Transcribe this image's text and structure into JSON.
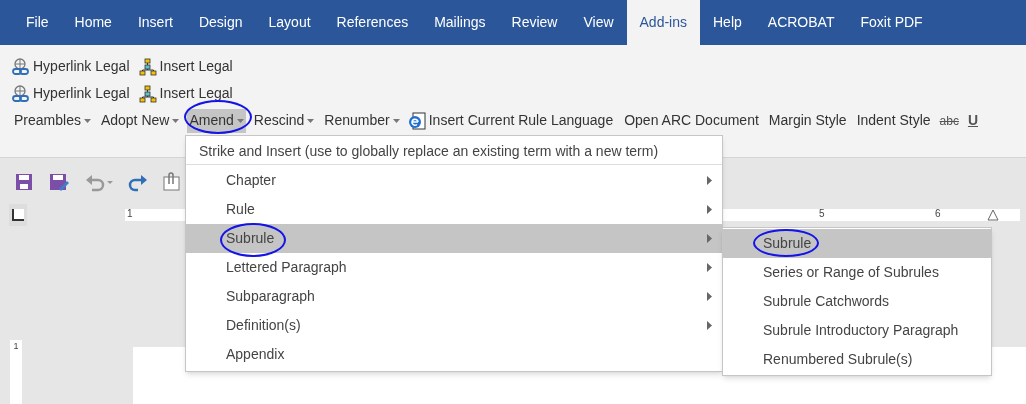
{
  "tabs": [
    {
      "label": "File",
      "selected": false
    },
    {
      "label": "Home",
      "selected": false
    },
    {
      "label": "Insert",
      "selected": false
    },
    {
      "label": "Design",
      "selected": false
    },
    {
      "label": "Layout",
      "selected": false
    },
    {
      "label": "References",
      "selected": false
    },
    {
      "label": "Mailings",
      "selected": false
    },
    {
      "label": "Review",
      "selected": false
    },
    {
      "label": "View",
      "selected": false
    },
    {
      "label": "Add-ins",
      "selected": true
    },
    {
      "label": "Help",
      "selected": false
    },
    {
      "label": "ACROBAT",
      "selected": false
    },
    {
      "label": "Foxit PDF",
      "selected": false
    }
  ],
  "ribbon": {
    "rows": [
      [
        {
          "kind": "hyperlink",
          "label": "Hyperlink Legal"
        },
        {
          "kind": "tree",
          "label": "Insert Legal"
        }
      ],
      [
        {
          "kind": "hyperlink",
          "label": "Hyperlink Legal"
        },
        {
          "kind": "tree",
          "label": "Insert Legal"
        }
      ],
      [
        {
          "kind": "dropdown",
          "label": "Preambles",
          "selected": false
        },
        {
          "kind": "dropdown",
          "label": "Adopt New",
          "selected": false
        },
        {
          "kind": "dropdown",
          "label": "Amend",
          "selected": true
        },
        {
          "kind": "dropdown",
          "label": "Rescind",
          "selected": false
        },
        {
          "kind": "dropdown",
          "label": "Renumber",
          "selected": false
        },
        {
          "kind": "doc",
          "label": "Insert Current Rule Language"
        },
        {
          "kind": "plain",
          "label": "Open ARC Document"
        },
        {
          "kind": "plain",
          "label": "Margin Style"
        },
        {
          "kind": "plain",
          "label": "Indent Style"
        },
        {
          "kind": "strike",
          "label": "abc"
        },
        {
          "kind": "underline",
          "label": "U"
        }
      ]
    ]
  },
  "ruler": {
    "labels": [
      "1",
      "5",
      "6"
    ],
    "vertical_label": "1"
  },
  "menu": {
    "header": "Strike and Insert (use to globally replace an existing term with a new term)",
    "items": [
      {
        "label": "Chapter",
        "submenu": true,
        "selected": false
      },
      {
        "label": "Rule",
        "submenu": true,
        "selected": false
      },
      {
        "label": "Subrule",
        "submenu": true,
        "selected": true
      },
      {
        "label": "Lettered Paragraph",
        "submenu": true,
        "selected": false
      },
      {
        "label": "Subparagraph",
        "submenu": true,
        "selected": false
      },
      {
        "label": "Definition(s)",
        "submenu": true,
        "selected": false
      },
      {
        "label": "Appendix",
        "submenu": false,
        "selected": false
      }
    ]
  },
  "submenu": {
    "items": [
      {
        "label": "Subrule",
        "selected": true
      },
      {
        "label": "Series or Range of Subrules",
        "selected": false
      },
      {
        "label": "Subrule Catchwords",
        "selected": false
      },
      {
        "label": "Subrule Introductory Paragraph",
        "selected": false
      },
      {
        "label": "Renumbered Subrule(s)",
        "selected": false
      }
    ]
  }
}
